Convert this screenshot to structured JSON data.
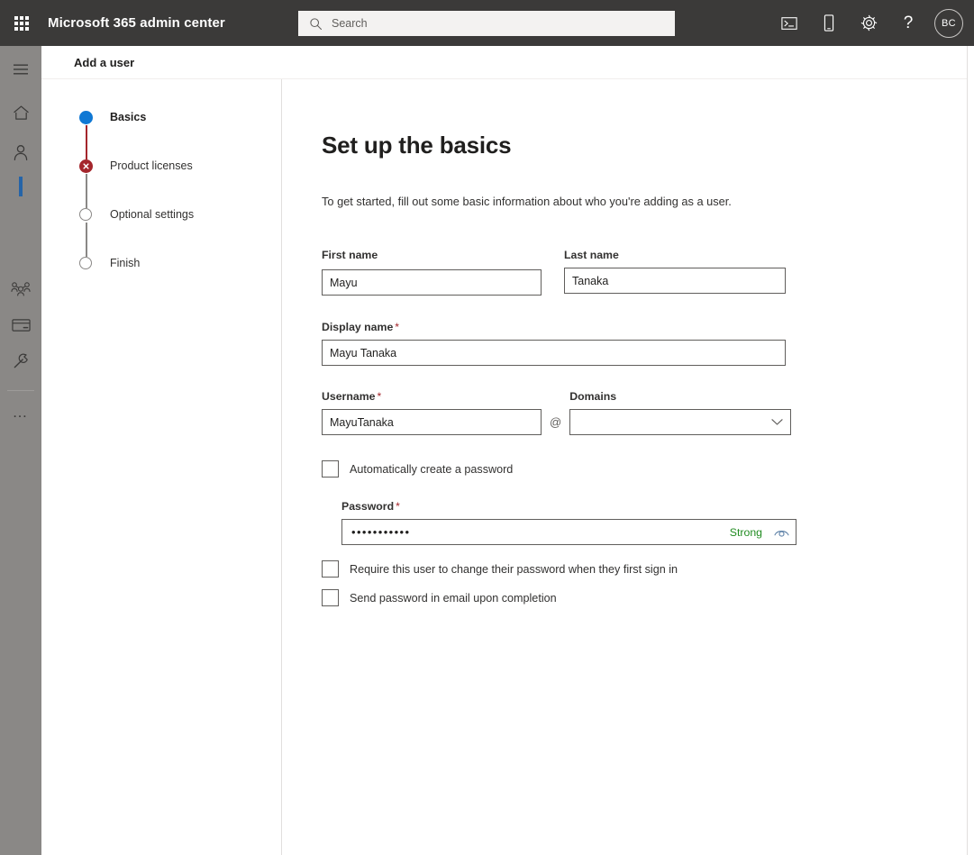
{
  "suite": {
    "waffle_icon": "app-launcher-icon",
    "title": "Microsoft 365 admin center",
    "search": {
      "icon": "search-icon",
      "placeholder": "Search",
      "value": ""
    },
    "actions": [
      {
        "name": "console-icon",
        "glyph": "terminal"
      },
      {
        "name": "mobile-device-icon",
        "glyph": "phone"
      },
      {
        "name": "settings-gear-icon",
        "glyph": "gear"
      },
      {
        "name": "help-icon",
        "label": "?"
      }
    ],
    "avatar_initials": "BC"
  },
  "rail": {
    "items": [
      {
        "name": "hamburger-menu-icon",
        "label": "Menu"
      },
      {
        "name": "home-icon",
        "label": "Home"
      },
      {
        "name": "users-icon",
        "label": "Users"
      },
      {
        "name": "teams-groups-icon",
        "label": "Teams & groups"
      },
      {
        "name": "billing-icon",
        "label": "Billing"
      },
      {
        "name": "setup-wrench-icon",
        "label": "Setup"
      },
      {
        "name": "show-all-icon",
        "label": "…"
      }
    ]
  },
  "page": {
    "header_title": "Add a user"
  },
  "wizard": {
    "steps": [
      {
        "label": "Basics",
        "state": "active"
      },
      {
        "label": "Product licenses",
        "state": "error"
      },
      {
        "label": "Optional settings",
        "state": "pending"
      },
      {
        "label": "Finish",
        "state": "pending"
      }
    ]
  },
  "form": {
    "title": "Set up the basics",
    "intro": "To get started, fill out some basic information about who you're adding as a user.",
    "first_name": {
      "label": "First name",
      "value": "Mayu",
      "required": false
    },
    "last_name": {
      "label": "Last name",
      "value": "Tanaka",
      "required": false
    },
    "display_name": {
      "label": "Display name",
      "value": "Mayu Tanaka",
      "required": true
    },
    "username": {
      "label": "Username",
      "value": "MayuTanaka",
      "required": true
    },
    "at_separator": "@",
    "domains": {
      "label": "Domains",
      "value": "",
      "placeholder": ""
    },
    "auto_password_checkbox": {
      "label": "Automatically create a password",
      "checked": false
    },
    "password": {
      "label": "Password",
      "required": true,
      "masked_value": "•••••••••••",
      "strength_label": "Strong",
      "reveal_icon": "eye-icon"
    },
    "require_change_checkbox": {
      "label": "Require this user to change their password when they first sign in",
      "checked": false
    },
    "send_email_checkbox": {
      "label": "Send password in email upon completion",
      "checked": false
    }
  },
  "required_marker": "*",
  "colors": {
    "suite_bar": "#3b3a39",
    "rail": "#8a8886",
    "accent_blue": "#0f78d4",
    "rail_active": "#2564a8",
    "error_red": "#a4262c",
    "strong_green": "#218c21"
  }
}
